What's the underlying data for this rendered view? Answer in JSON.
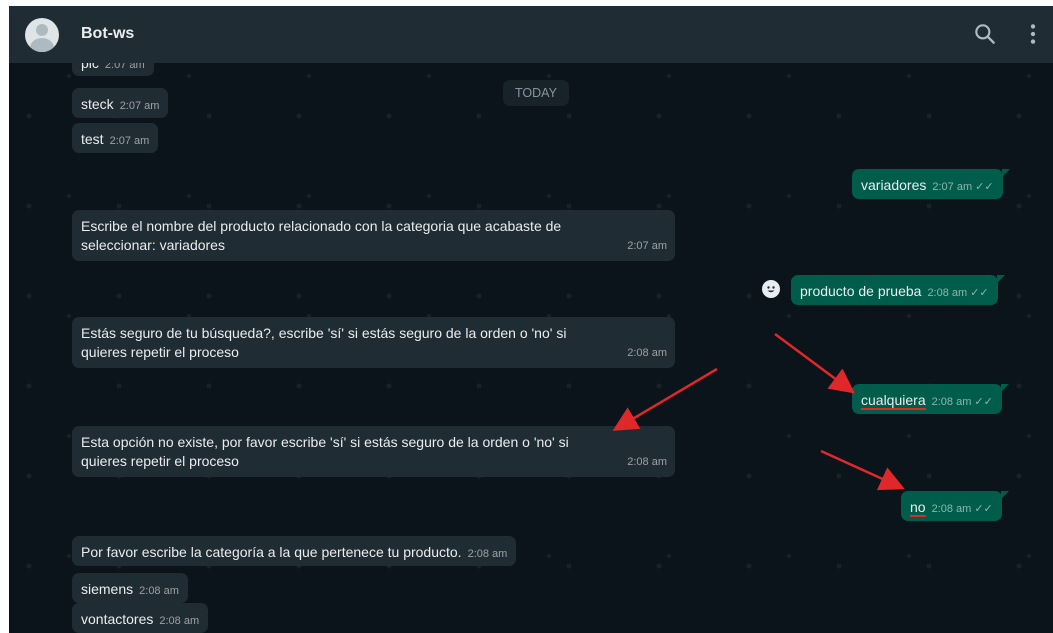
{
  "header": {
    "contact_name": "Bot-ws",
    "icons": [
      "avatar-icon",
      "search-icon",
      "kebab-menu-icon"
    ]
  },
  "date_chip": "TODAY",
  "messages": [
    {
      "dir": "in",
      "text": "pic",
      "time": "2:07 am"
    },
    {
      "dir": "in",
      "text": "steck",
      "time": "2:07 am"
    },
    {
      "dir": "in",
      "text": "test",
      "time": "2:07 am"
    },
    {
      "dir": "out",
      "text": "variadores",
      "time": "2:07 am"
    },
    {
      "dir": "in",
      "text": "Escribe el nombre del producto relacionado con la categoria que acabaste de seleccionar: variadores",
      "time": "2:07 am"
    },
    {
      "dir": "out",
      "text": "producto de prueba",
      "time": "2:08 am"
    },
    {
      "dir": "in",
      "text": "Estás seguro de tu búsqueda?, escribe 'sí' si estás seguro de la orden o 'no' si quieres repetir el proceso",
      "time": "2:08 am"
    },
    {
      "dir": "out",
      "text": "cualquiera",
      "time": "2:08 am"
    },
    {
      "dir": "in",
      "text": "Esta opción no existe, por favor escribe 'sí' si estás seguro de la orden o 'no' si quieres repetir el proceso",
      "time": "2:08 am"
    },
    {
      "dir": "out",
      "text": "no",
      "time": "2:08 am"
    },
    {
      "dir": "in",
      "text": "Por favor escribe la categoría a la que pertenece tu producto.",
      "time": "2:08 am"
    },
    {
      "dir": "in",
      "text": "siemens",
      "time": "2:08 am"
    },
    {
      "dir": "in",
      "text": "vontactores",
      "time": "2:08 am"
    }
  ],
  "colors": {
    "background": "#0b141a",
    "header": "#202c33",
    "incoming_bubble": "#202c33",
    "outgoing_bubble": "#005c4b",
    "annotation_arrow": "#e0282a"
  }
}
